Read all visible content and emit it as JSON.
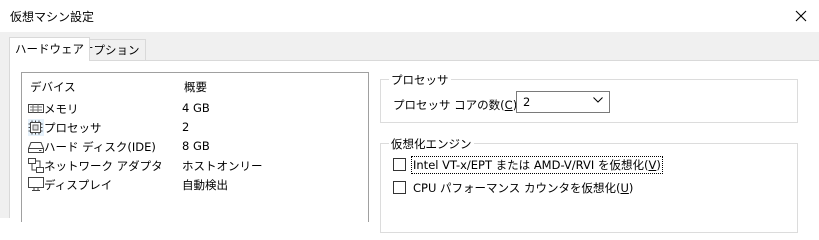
{
  "window": {
    "title": "仮想マシン設定"
  },
  "tabs": [
    {
      "label": "ハードウェア",
      "active": true
    },
    {
      "label": "オプション",
      "active": false
    }
  ],
  "device_list": {
    "columns": [
      "デバイス",
      "概要"
    ],
    "rows": [
      {
        "icon": "memory-icon",
        "name": "メモリ",
        "summary": "4 GB"
      },
      {
        "icon": "processor-icon",
        "name": "プロセッサ",
        "summary": "2",
        "selected": true
      },
      {
        "icon": "hard-disk-icon",
        "name": "ハード ディスク(IDE)",
        "summary": "8 GB"
      },
      {
        "icon": "network-adapter-icon",
        "name": "ネットワーク アダプタ",
        "summary": "ホストオンリー"
      },
      {
        "icon": "display-icon",
        "name": "ディスプレイ",
        "summary": "自動検出"
      }
    ]
  },
  "processors": {
    "group_label": "プロセッサ",
    "cores_label_prefix": "プロセッサ コアの数(",
    "cores_label_key": "C",
    "cores_label_suffix": "):",
    "cores_value": "2"
  },
  "virtualization": {
    "group_label": "仮想化エンジン",
    "options": [
      {
        "prefix": "Intel VT-x/EPT または AMD-V/RVI を仮想化(",
        "key": "V",
        "suffix": ")",
        "checked": false,
        "focused": true
      },
      {
        "prefix": "CPU パフォーマンス カウンタを仮想化(",
        "key": "U",
        "suffix": ")",
        "checked": false,
        "focused": false
      }
    ]
  },
  "colors": {
    "selection": "#e5f1fb",
    "panel_bg": "#f0f0f0",
    "border": "#d9d9d9"
  }
}
